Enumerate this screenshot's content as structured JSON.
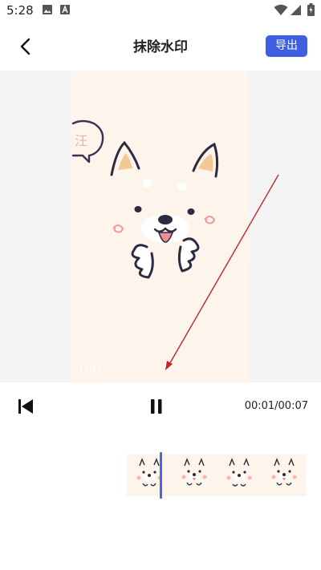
{
  "status_bar": {
    "time": "5:28",
    "icons": [
      "image-icon",
      "font-icon",
      "wifi-icon",
      "signal-icon",
      "battery-icon"
    ]
  },
  "app_bar": {
    "title": "抹除水印",
    "export_label": "导出",
    "back_icon": "chevron-left-icon"
  },
  "video": {
    "speech_bubble_text": "汪",
    "watermark_text": "DIU"
  },
  "player": {
    "current_time": "00:01",
    "total_time": "00:07",
    "time_display": "00:01/00:07",
    "icons": [
      "skip-previous-icon",
      "pause-icon"
    ]
  },
  "timeline": {
    "thumbnail_count": 4,
    "playhead_progress": 0.18
  },
  "colors": {
    "accent": "#3f5fe0",
    "playhead": "#4a64e6",
    "frame_bg": "#fdf4eb",
    "arrow": "#c0282c"
  }
}
